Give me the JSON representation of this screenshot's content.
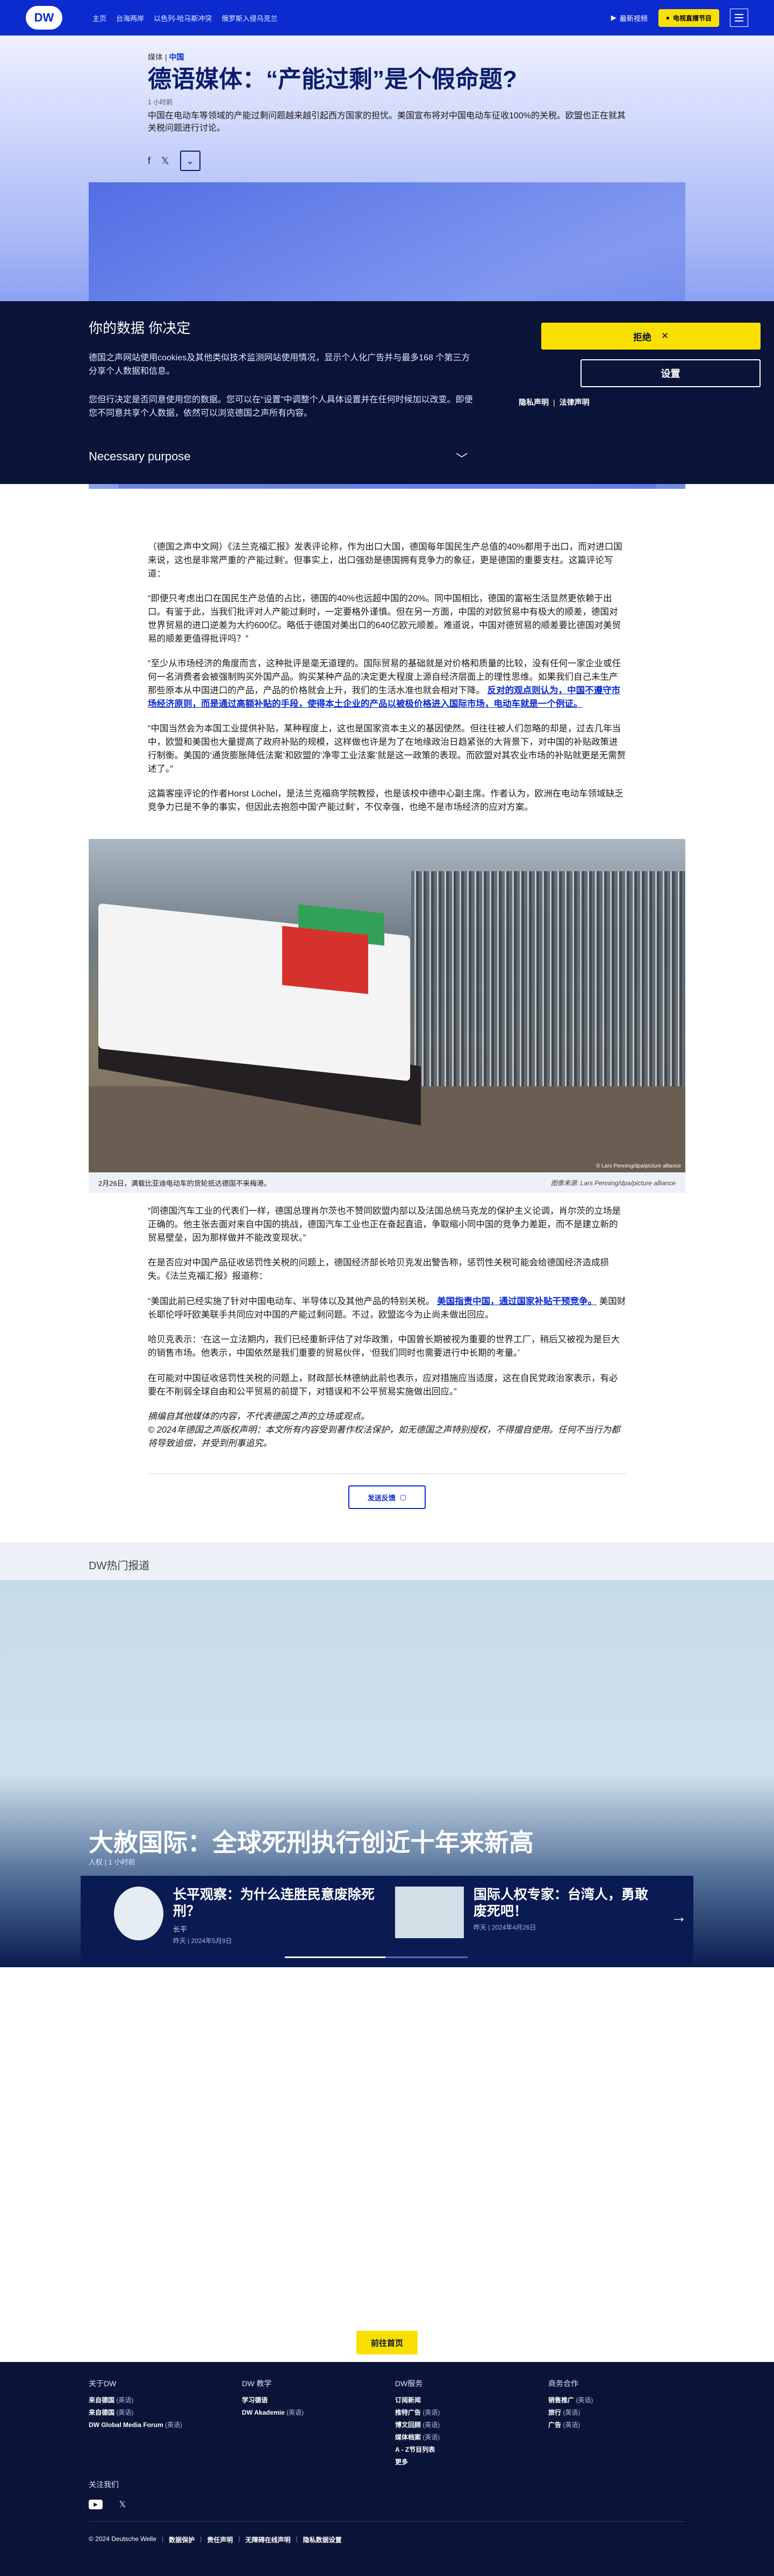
{
  "header": {
    "logo": "DW",
    "nav": [
      "主页",
      "台海两岸",
      "以色列-哈马斯冲突",
      "俄罗斯入侵乌克兰"
    ],
    "live_label": "最新视频",
    "tv_button": "电视直播节目",
    "colors": {
      "brand": "#0b2bcf",
      "accent": "#f9e000"
    }
  },
  "article": {
    "kicker_prefix": "媒体",
    "kicker_section": "中国",
    "title": "德语媒体：“产能过剩”是个假命题?",
    "time": "1 小时前",
    "teaser": "中国在电动车等领域的产能过剩问题越来越引起西方国家的担忧。美国宣布将对中国电动车征收100%的关税。欧盟也正在就其关税问题进行讨论。",
    "share_icons": [
      "facebook-icon",
      "x-icon",
      "more-icon"
    ],
    "paragraphs_1": [
      "（德国之声中文网）《法兰克福汇报》发表评论称，作为出口大国，德国每年国民生产总值的40%都用于出口，而对进口国来说，这也是非常严重的‘产能过剩’。但事实上，出口强劲是德国拥有竞争力的象征，更是德国的重要支柱。这篇评论写道：",
      "“即便只考虑出口在国民生产总值的占比，德国的40%也远超中国的20%。同中国相比，德国的富裕生活显然更依赖于出口。有鉴于此，当我们批评对人产能过剩时，一定要格外谨慎。但在另一方面，中国的对欧贸易中有极大的顺差，德国对世界贸易的进口逆差为大约600亿。略低于德国对美出口的640亿欧元顺差。难道说，中国对德贸易的顺差要比德国对美贸易的顺差更值得批评吗？”",
      "“至少从市场经济的角度而言，这种批评是毫无道理的。国际贸易的基础就是对价格和质量的比较，没有任何一家企业或任何一名消费者会被强制购买外国产品。购买某种产品的决定更大程度上源自经济层面上的理性思维。如果我们自己未生产那些原本从中国进口的产品，产品的价格就会上升，我们的生活水准也就会相对下降。",
      "“中国当然会为本国工业提供补贴，某种程度上，这也是国家资本主义的基因使然。但往往被人们忽略的却是，过去几年当中，欧盟和美国也大量提高了政府补贴的规模，这样做也许是为了在地缘政治日趋紧张的大背景下，对中国的补贴政策进行制衡。美国的‘通货膨胀降低法案’和欧盟的‘净零工业法案’就是这一政策的表现。而欧盟对其农业市场的补贴就更是无需赘述了。”",
      "这篇客座评论的作者Horst Löchel，是法兰克福商学院教授，也是该校中德中心副主席。作者认为，欧洲在电动车领域缺乏竞争力已是不争的事实，但因此去抱怨中国‘产能过剩’，不仅幸强，也绝不是市场经济的应对方案。"
    ],
    "link_1": "反对的观点则认为，中国不遵守市场经济原则，而是通过高额补贴的手段，使得本土企业的产品以被极价格进入国际市场，电动车就是一个例证。",
    "figure": {
      "caption": "2月26日，满载比亚迪电动车的货轮抵达德国不来梅港。",
      "credit": "图像来源: Lars Penning/dpa/picture alliance",
      "credit_small": "© Lars Penning/dpa/picture alliance"
    },
    "paragraphs_2": [
      "“同德国汽车工业的代表们一样，德国总理肖尔茨也不赞同欧盟内部以及法国总统马克龙的保护主义论调，肖尔茨的立场是正确的。他主张去面对来自中国的挑战，德国汽车工业也正在奋起直追，争取缩小同中国的竞争力差距，而不是建立新的贸易壁垒，因为那样做并不能改变现状。”",
      "在是否应对中国产品征收惩罚性关税的问题上，德国经济部长哈贝克发出警告称，惩罚性关税可能会给德国经济造成损失。《法兰克福汇报》报道称：",
      "“美国此前已经实施了针对中国电动车、半导体以及其他产品的特别关税。",
      "哈贝克表示：‘在这一立法期内，我们已经重新评估了对华政策，中国曾长期被视为重要的世界工厂，稍后又被视为是巨大的销售市场。他表示，中国依然是我们重要的贸易伙伴，‘但我们同时也需要进行中长期的考量。’",
      "在可能对中国征收惩罚性关税的问题上，财政部长林德纳此前也表示，应对措施应当适度，这在自民党政治家表示，有必要在不削弱全球自由和公平贸易的前提下，对错误和不公平贸易实施做出回应。”"
    ],
    "link_2": "美国指责中国，通过国家补贴干预竞争。",
    "para_2_tail": "美国财长耶伦呼吁欧美联手共同应对中国的产能过剩问题。不过，欧盟迄今为止尚未做出回应。",
    "footnote_1": "摘编自其他媒体的内容，不代表德国之声的立场或观点。",
    "footnote_2": "© 2024年德国之声版权声明：本文所有内容受到著作权法保护，如无德国之声特别授权，不得擅自使用。任何不当行为都将导致追偿，并受到刑事追究。",
    "feedback_label": "发送反馈"
  },
  "cookie": {
    "title": "你的数据 你决定",
    "p1": "德国之声网站使用cookies及其他类似技术监测网站使用情况，显示个人化广告并与最多168 个第三方分享个人数据和信息。",
    "p2": "您但行决定是否同意使用您的数据。您可以在“设置”中调整个人具体设置并在任何时候加以改变。即便您不同意共享个人数据，依然可以浏览德国之声所有内容。",
    "purpose": "Necessary purpose",
    "reject": "拒绝",
    "settings": "设置",
    "privacy": "隐私声明",
    "legal": "法律声明"
  },
  "hot": {
    "section_title": "DW热门报道",
    "headline": "大赦国际：全球死刑执行创近十年来新高",
    "meta_tag": "人权",
    "meta_time": "1 小时前",
    "cards": [
      {
        "title": "长平观察：为什么连胜民意废除死刑？",
        "tag": "长平",
        "date": "昨天 | 2024年5月9日"
      },
      {
        "title": "国际人权专家：台湾人，勇敢废死吧！",
        "tag": "人权",
        "date": "昨天 | 2024年4月26日"
      }
    ],
    "progress": 0.55,
    "more_label": "前往首页"
  },
  "footer": {
    "cols": [
      {
        "title": "关于DW",
        "items": [
          [
            "来自德国",
            "(英语)"
          ],
          [
            "来自德国",
            "(英语)"
          ],
          [
            "DW Global Media Forum",
            "(英语)"
          ]
        ]
      },
      {
        "title": "DW 教学",
        "items": [
          [
            "学习德语",
            ""
          ],
          [
            "DW Akademie",
            "(英语)"
          ]
        ]
      },
      {
        "title": "DW服务",
        "items": [
          [
            "订阅新闻",
            ""
          ],
          [
            "推特广告",
            "(英语)"
          ],
          [
            "博文回顾",
            "(英语)"
          ],
          [
            "媒体档案",
            "(英语)"
          ],
          [
            "A - Z节目列表",
            ""
          ],
          [
            "更多",
            ""
          ]
        ]
      },
      {
        "title": "商务合作",
        "items": [
          [
            "销售推广",
            "(英语)"
          ],
          [
            "旅行",
            "(英语)"
          ],
          [
            "广告",
            "(英语)"
          ]
        ]
      }
    ],
    "follow": "关注我们",
    "social_icons": [
      "youtube-icon",
      "x-icon"
    ],
    "legal": [
      "© 2024 Deutsche Welle",
      "数据保护",
      "责任声明",
      "无障碍在线声明",
      "隐私数据设置"
    ]
  }
}
